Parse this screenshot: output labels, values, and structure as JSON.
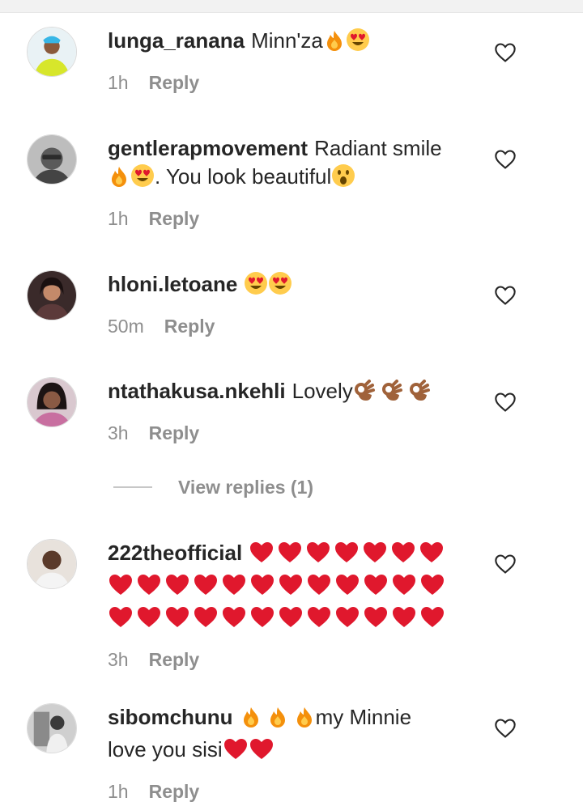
{
  "comments": [
    {
      "username": "lunga_ranana",
      "text": "Minn'za",
      "emoji": [
        "fire-emoji",
        "heart-eyes-emoji"
      ],
      "time": "1h",
      "reply": "Reply"
    },
    {
      "username": "gentlerapmovement",
      "text_a": "Radiant smile",
      "text_b": ". You look beautiful",
      "emoji_a": [
        "fire-emoji",
        "heart-eyes-emoji"
      ],
      "emoji_b": [
        "surprised-emoji"
      ],
      "time": "1h",
      "reply": "Reply"
    },
    {
      "username": "hloni.letoane",
      "text": "",
      "emoji": [
        "heart-eyes-emoji",
        "heart-eyes-emoji"
      ],
      "time": "50m",
      "reply": "Reply"
    },
    {
      "username": "ntathakusa.nkehli",
      "text": "Lovely",
      "emoji": [
        "ok-hand-emoji",
        "ok-hand-emoji",
        "ok-hand-emoji"
      ],
      "time": "3h",
      "reply": "Reply"
    },
    {
      "username": "222theofficial",
      "text": "",
      "emoji_count": 31,
      "emoji_name": "red-heart-emoji",
      "time": "3h",
      "reply": "Reply"
    },
    {
      "username": "sibomchunu",
      "text_a": "my Minnie",
      "text_b": "love you sisi",
      "emoji_a": [
        "fire-emoji",
        "fire-emoji",
        "fire-emoji"
      ],
      "emoji_b": [
        "red-heart-emoji",
        "red-heart-emoji"
      ],
      "time": "1h",
      "reply": "Reply"
    }
  ],
  "view_replies": "View replies (1)",
  "icons": {
    "like": "heart-outline-icon"
  },
  "colors": {
    "muted": "#8e8e8e",
    "text": "#262626",
    "heart": "#e0182d"
  }
}
